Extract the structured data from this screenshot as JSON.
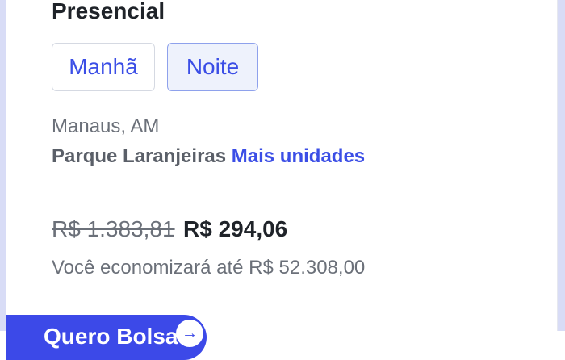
{
  "card": {
    "title": "Presencial",
    "shifts": [
      {
        "label": "Manhã",
        "selected": false
      },
      {
        "label": "Noite",
        "selected": true
      }
    ],
    "location": {
      "city": "Manaus, AM",
      "unit": "Parque Laranjeiras",
      "more_units_link": "Mais unidades"
    },
    "pricing": {
      "old_price": "R$ 1.383,81",
      "new_price": "R$ 294,06",
      "savings_text": "Você economizará até R$ 52.308,00"
    },
    "cta": {
      "label": "Quero Bolsa",
      "icon": "arrow-right-icon"
    }
  },
  "colors": {
    "accent": "#3b4ee6",
    "selected_bg": "#eef2fc",
    "text_dark": "#1f2329",
    "text_muted": "#6b7079"
  }
}
